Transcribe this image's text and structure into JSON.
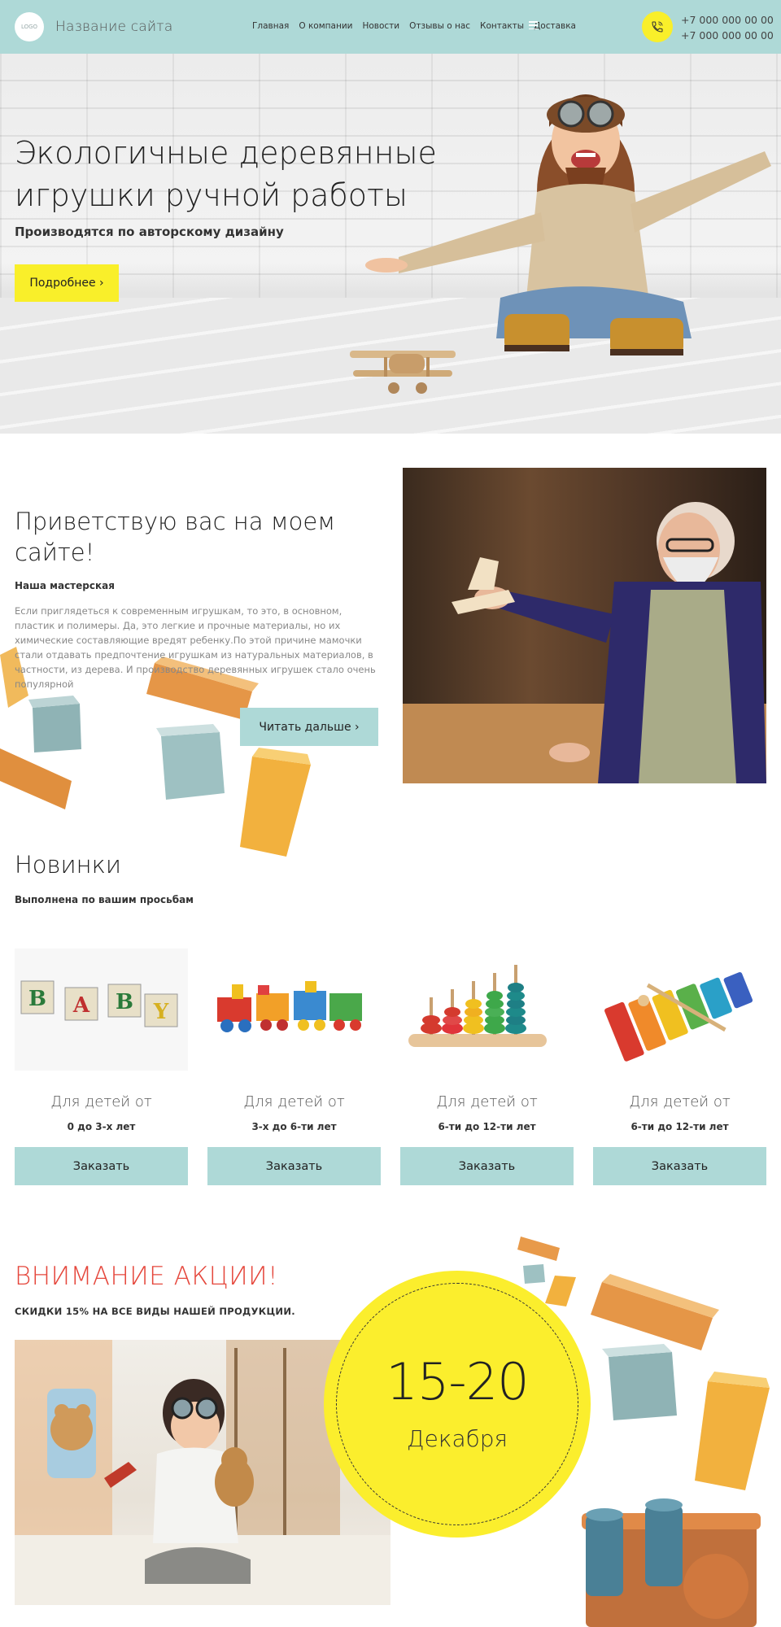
{
  "header": {
    "logo_text": "LOGO",
    "site_name": "Название сайта",
    "nav": [
      "Главная",
      "О компании",
      "Новости",
      "Отзывы о нас",
      "Контакты",
      "Доставка"
    ],
    "phones": [
      "+7 000 000 00 00",
      "+7 000 000 00 00"
    ]
  },
  "hero": {
    "title": "Экологичные деревянные игрушки ручной работы",
    "subtitle": "Производятся по авторскому дизайну",
    "button": "Подробнее ›"
  },
  "welcome": {
    "title": "Приветствую вас на моем сайте!",
    "subtitle": "Наша мастерская",
    "text": "Если приглядеться к современным игрушкам, то это, в основном, пластик и полимеры. Да, это легкие и прочные материалы, но их химические составляющие вредят ребенку.По этой причине мамочки стали отдавать предпочтение игрушкам из натуральных материалов, в частности, из дерева. И производство деревянных игрушек стало очень популярной",
    "button": "Читать дальше ›"
  },
  "new_items": {
    "title": "Новинки",
    "subtitle": "Выполнена по вашим просьбам",
    "products": [
      {
        "caption": "Для детей от",
        "age": "0 до 3-х лет",
        "button": "Заказать",
        "image": "abc-blocks"
      },
      {
        "caption": "Для детей от",
        "age": "3-х до 6-ти лет",
        "button": "Заказать",
        "image": "wooden-train"
      },
      {
        "caption": "Для детей от",
        "age": "6-ти до 12-ти лет",
        "button": "Заказать",
        "image": "ring-abacus"
      },
      {
        "caption": "Для детей от",
        "age": "6-ти до 12-ти лет",
        "button": "Заказать",
        "image": "xylophone"
      }
    ]
  },
  "promo": {
    "title": "ВНИМАНИЕ АКЦИИ!",
    "subtitle": "СКИДКИ 15% НА ВСЕ ВИДЫ НАШЕЙ ПРОДУКЦИИ.",
    "dates": "15-20",
    "month": "Декабря"
  },
  "colors": {
    "teal": "#aed9d7",
    "yellow": "#f9ef2a",
    "promo_red": "#e5473c"
  }
}
